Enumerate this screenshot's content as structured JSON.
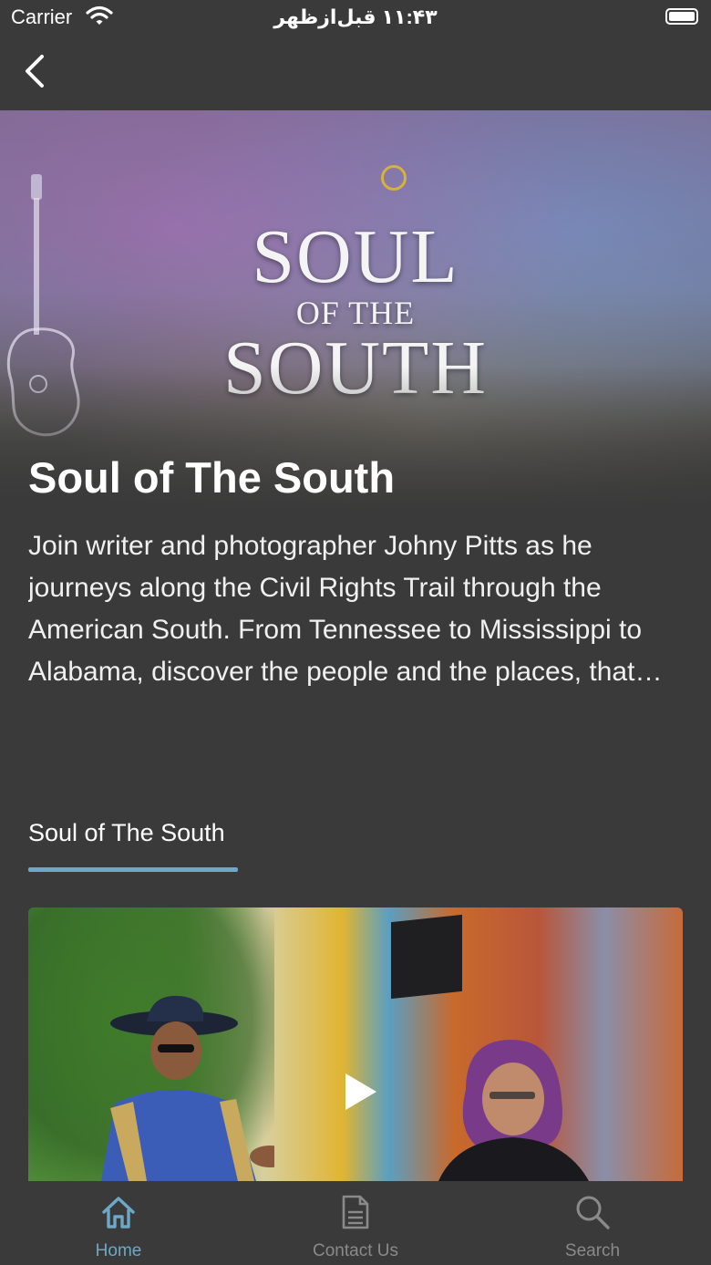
{
  "status_bar": {
    "carrier": "Carrier",
    "time": "۱۱:۴۳ قبل‌ازظهر"
  },
  "hero": {
    "logo_line1": "SOUL",
    "logo_line2": "OF THE",
    "logo_line3": "SOUTH"
  },
  "show": {
    "title": "Soul of The South",
    "description": "Join writer and photographer Johny Pitts as he journeys along the Civil Rights Trail through the American South. From Tennessee to Mississippi to Alabama, discover the people and the places, that shaped the movement."
  },
  "season_tab": {
    "label": "Soul of The South"
  },
  "tab_bar": {
    "items": [
      {
        "label": "Home",
        "icon": "home-icon",
        "active": true
      },
      {
        "label": "Contact Us",
        "icon": "document-icon",
        "active": false
      },
      {
        "label": "Search",
        "icon": "search-icon",
        "active": false
      }
    ]
  },
  "colors": {
    "background": "#3a3a3a",
    "accent": "#6ea8c7",
    "inactive_tab": "#8a8a8a"
  }
}
